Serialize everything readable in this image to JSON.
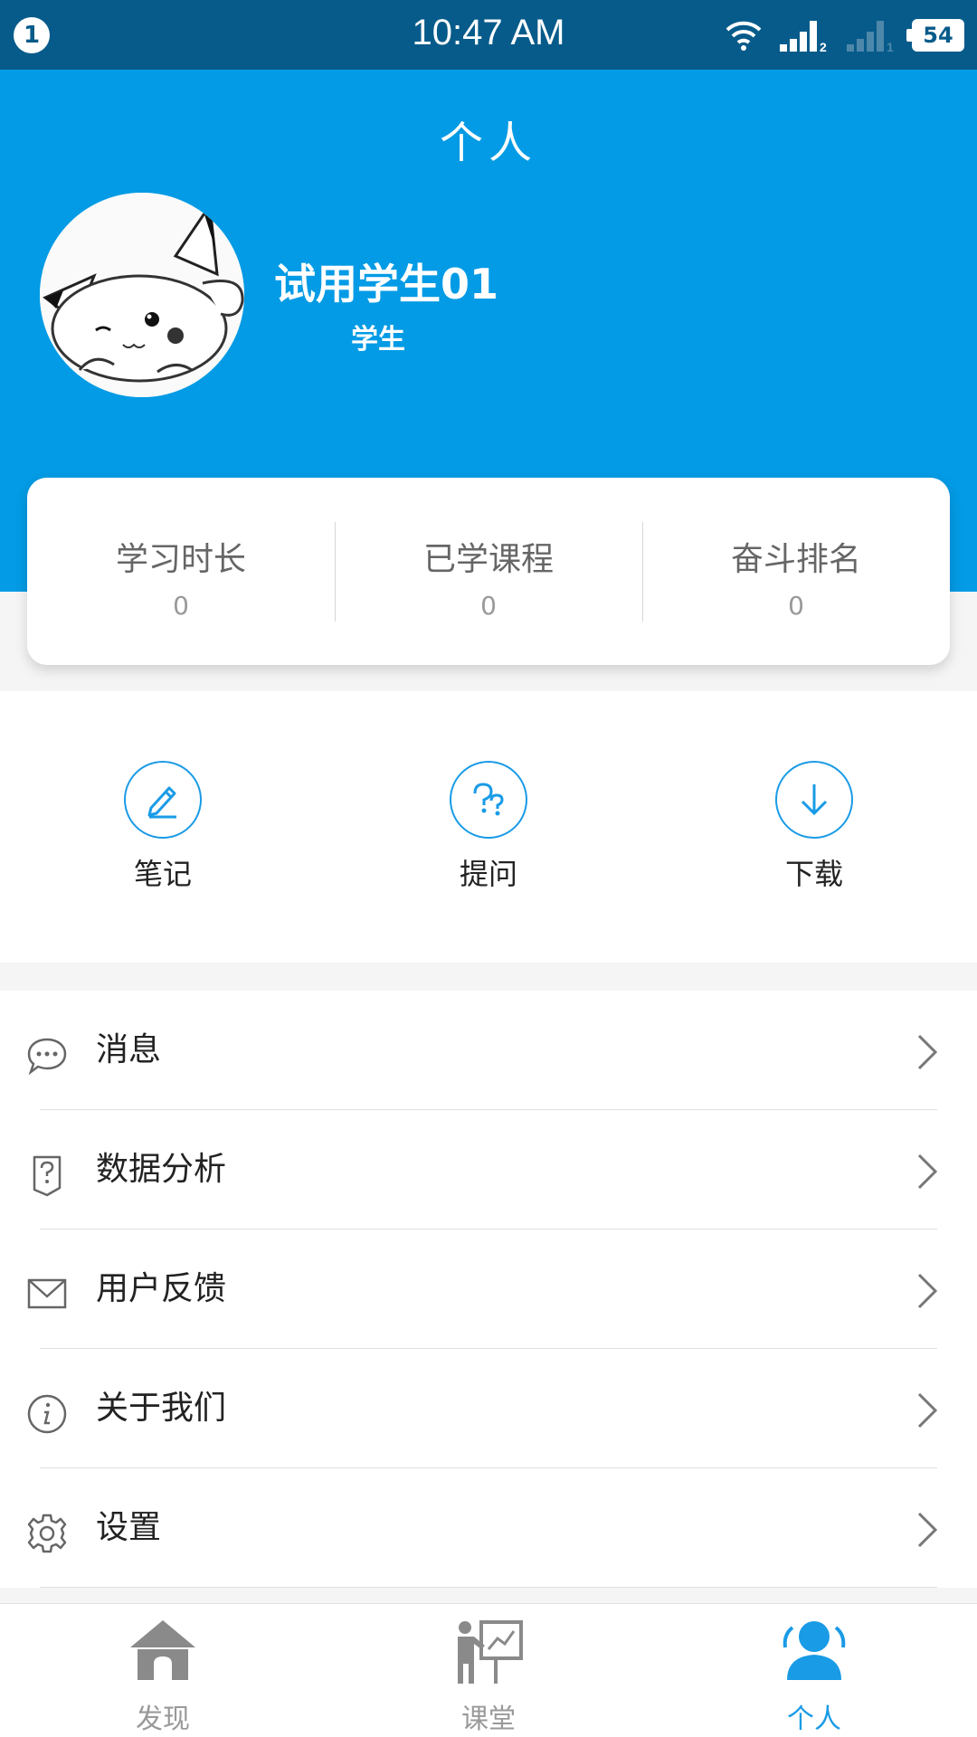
{
  "status_bar": {
    "notification_count": "1",
    "time": "10:47 AM",
    "battery": "54",
    "icons": [
      "wifi-icon",
      "signal-sim2-icon",
      "signal-sim1-icon",
      "battery-icon"
    ]
  },
  "header": {
    "title": "个人",
    "user_name": "试用学生01",
    "user_role": "学生"
  },
  "stats": [
    {
      "label": "学习时长",
      "value": "0"
    },
    {
      "label": "已学课程",
      "value": "0"
    },
    {
      "label": "奋斗排名",
      "value": "0"
    }
  ],
  "quick_actions": [
    {
      "label": "笔记",
      "icon": "pencil-icon"
    },
    {
      "label": "提问",
      "icon": "question-icon"
    },
    {
      "label": "下载",
      "icon": "download-icon"
    }
  ],
  "menu": [
    {
      "label": "消息",
      "icon": "chat-bubble-icon"
    },
    {
      "label": "数据分析",
      "icon": "document-question-icon"
    },
    {
      "label": "用户反馈",
      "icon": "envelope-icon"
    },
    {
      "label": "关于我们",
      "icon": "info-icon"
    },
    {
      "label": "设置",
      "icon": "gear-icon"
    }
  ],
  "bottom_nav": [
    {
      "label": "发现",
      "icon": "home-icon",
      "active": false
    },
    {
      "label": "课堂",
      "icon": "classroom-icon",
      "active": false
    },
    {
      "label": "个人",
      "icon": "person-icon",
      "active": true
    }
  ],
  "colors": {
    "status_bar": "#075b8a",
    "primary": "#039be5",
    "accent": "#1a9be6"
  }
}
